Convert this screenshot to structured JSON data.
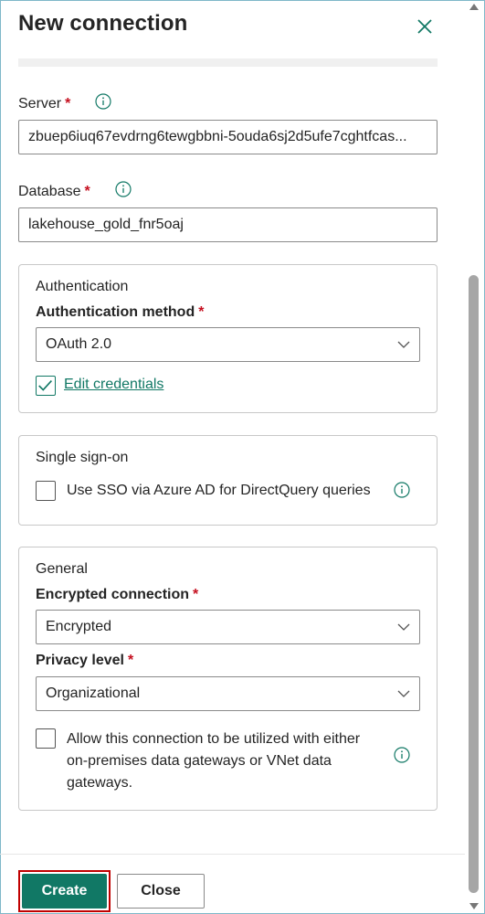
{
  "header": {
    "title": "New connection"
  },
  "server": {
    "label": "Server",
    "required_mark": "*",
    "value": "zbuep6iuq67evdrng6tewgbbni-5ouda6sj2d5ufe7cghtfcas..."
  },
  "database": {
    "label": "Database",
    "required_mark": "*",
    "value": "lakehouse_gold_fnr5oaj"
  },
  "authentication": {
    "title": "Authentication",
    "method_label": "Authentication method",
    "required_mark": "*",
    "method_value": "OAuth 2.0",
    "edit_credentials": "Edit credentials",
    "edit_checked": true
  },
  "sso": {
    "title": "Single sign-on",
    "checkbox_label": "Use SSO via Azure AD for DirectQuery queries",
    "checked": false
  },
  "general": {
    "title": "General",
    "encrypted_label": "Encrypted connection",
    "encrypted_required": "*",
    "encrypted_value": "Encrypted",
    "privacy_label": "Privacy level",
    "privacy_required": "*",
    "privacy_value": "Organizational",
    "gateway_line1": "Allow this connection to be utilized with either",
    "gateway_line2": "on-premises data gateways or VNet data",
    "gateway_line3": "gateways.",
    "gateway_checked": false
  },
  "footer": {
    "create_label": "Create",
    "close_label": "Close"
  },
  "colors": {
    "accent": "#117865",
    "required": "#c50f1f",
    "highlight": "#c00000"
  }
}
